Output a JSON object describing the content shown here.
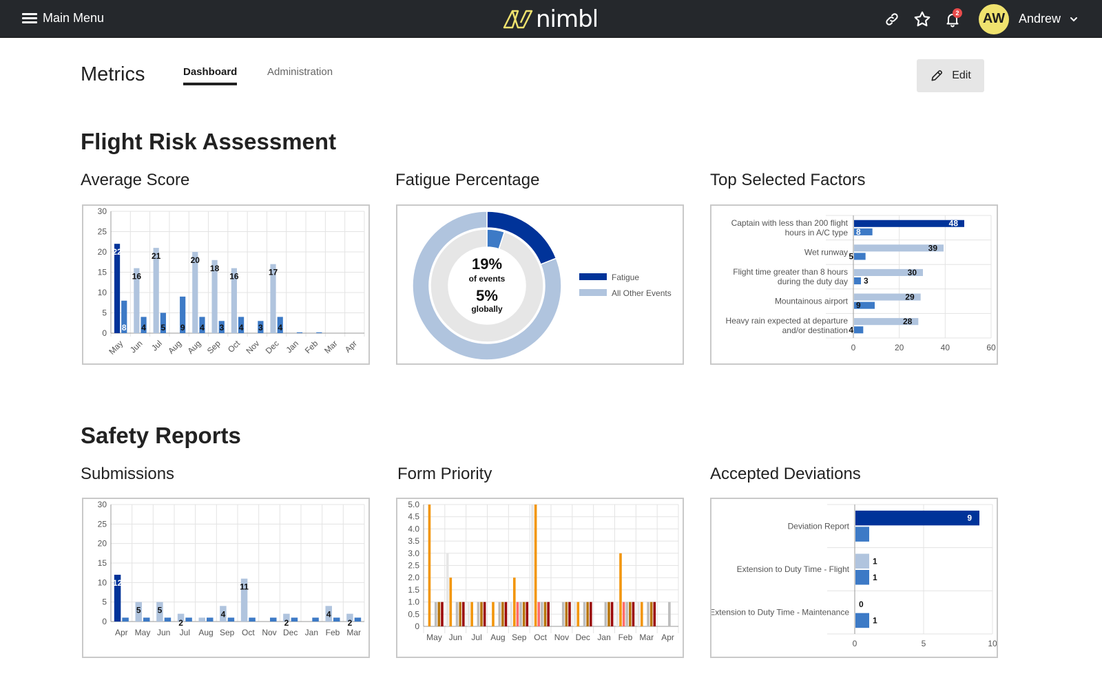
{
  "topbar": {
    "menu_label": "Main Menu",
    "brand": "nimbl",
    "notification_count": "2",
    "avatar_initials": "AW",
    "user_name": "Andrew",
    "brand_color": "#efe26e"
  },
  "header": {
    "title": "Metrics",
    "tabs": [
      {
        "label": "Dashboard",
        "active": true
      },
      {
        "label": "Administration",
        "active": false
      }
    ],
    "edit_label": "Edit"
  },
  "sections": [
    {
      "title": "Flight Risk Assessment"
    },
    {
      "title": "Safety Reports"
    }
  ],
  "chart_titles": {
    "average_score": "Average Score",
    "fatigue": "Fatigue Percentage",
    "top_factors": "Top Selected Factors",
    "submissions": "Submissions",
    "form_priority": "Form Priority",
    "accepted_deviations": "Accepted Deviations"
  },
  "chart_data": [
    {
      "id": "average_score",
      "type": "bar",
      "title": "Average Score",
      "categories": [
        "May",
        "Jun",
        "Jul",
        "Aug",
        "Aug",
        "Sep",
        "Oct",
        "Nov",
        "Dec",
        "Jan",
        "Feb",
        "Mar",
        "Apr"
      ],
      "series": [
        {
          "name": "highlight",
          "color": "#003399",
          "values": [
            22,
            null,
            null,
            null,
            null,
            null,
            null,
            null,
            null,
            null,
            null,
            null,
            null
          ]
        },
        {
          "name": "average",
          "color": "#b0c4de",
          "values": [
            null,
            16,
            21,
            null,
            20,
            18,
            16,
            null,
            17,
            null,
            null,
            null,
            null
          ]
        },
        {
          "name": "count",
          "color": "#3d7ac6",
          "values": [
            8,
            4,
            5,
            9,
            4,
            3,
            4,
            3,
            4,
            0.2,
            0.2,
            0,
            0
          ]
        }
      ],
      "labels": {
        "highlight": [
          "22"
        ],
        "average": [
          "16",
          "21",
          "20",
          "18",
          "16",
          "17"
        ],
        "count": [
          "8",
          "4",
          "5",
          "9",
          "4",
          "3",
          "4",
          "3",
          "4"
        ]
      },
      "yticks": [
        0,
        5,
        10,
        15,
        20,
        25,
        30
      ],
      "ylim": [
        0,
        30
      ],
      "grid": true
    },
    {
      "id": "fatigue",
      "type": "pie",
      "title": "Fatigue Percentage",
      "outer": [
        {
          "label": "Fatigue",
          "value": 19,
          "color": "#003399"
        },
        {
          "label": "All Other Events",
          "value": 81,
          "color": "#b0c4de"
        }
      ],
      "inner": [
        {
          "label": "Fatigue globally",
          "value": 5,
          "color": "#3d7ac6"
        },
        {
          "label": "Other",
          "value": 95,
          "color": "#e6e6e6"
        }
      ],
      "center": {
        "pct1": "19%",
        "line1": "of events",
        "pct2": "5%",
        "line2": "globally"
      },
      "legend": [
        {
          "label": "Fatigue",
          "color": "#003399"
        },
        {
          "label": "All Other Events",
          "color": "#b0c4de"
        }
      ],
      "legend_position": "right"
    },
    {
      "id": "top_factors",
      "type": "bar",
      "orientation": "horizontal",
      "title": "Top Selected Factors",
      "categories": [
        [
          "Captain with less than 200 flight",
          "hours in A/C type"
        ],
        [
          "Wet runway"
        ],
        [
          "Flight time greater than 8 hours",
          "during the duty day"
        ],
        [
          "Mountainous airport"
        ],
        [
          "Heavy rain expected at departure",
          "and/or destination"
        ]
      ],
      "series": [
        {
          "name": "primary",
          "values": [
            48,
            39,
            30,
            29,
            28
          ],
          "colors": [
            "#003399",
            "#b0c4de",
            "#b0c4de",
            "#b0c4de",
            "#b0c4de"
          ]
        },
        {
          "name": "secondary",
          "color": "#3d7ac6",
          "values": [
            8,
            5,
            3,
            9,
            4
          ]
        }
      ],
      "xticks": [
        0,
        20,
        40,
        60
      ],
      "xlim": [
        0,
        60
      ],
      "grid": true
    },
    {
      "id": "submissions",
      "type": "bar",
      "title": "Submissions",
      "categories": [
        "Apr",
        "May",
        "Jun",
        "Jul",
        "Aug",
        "Sep",
        "Oct",
        "Nov",
        "Dec",
        "Jan",
        "Feb",
        "Mar"
      ],
      "series": [
        {
          "name": "primary",
          "values": [
            12,
            5,
            5,
            2,
            1,
            4,
            11,
            0,
            2,
            0,
            4,
            2
          ],
          "colors": [
            "#003399",
            "#b0c4de",
            "#b0c4de",
            "#b0c4de",
            "#b0c4de",
            "#b0c4de",
            "#b0c4de",
            "#b0c4de",
            "#b0c4de",
            "#b0c4de",
            "#b0c4de",
            "#b0c4de"
          ]
        },
        {
          "name": "secondary",
          "color": "#3d7ac6",
          "values": [
            1,
            1,
            1,
            1,
            1,
            1,
            1,
            1,
            1,
            1,
            1,
            1
          ]
        }
      ],
      "labels": [
        "12",
        "5",
        "5",
        "2",
        "",
        "4",
        "11",
        "",
        "2",
        "",
        "4",
        "2"
      ],
      "yticks": [
        0,
        5,
        10,
        15,
        20,
        25,
        30
      ],
      "ylim": [
        0,
        30
      ],
      "grid": true
    },
    {
      "id": "form_priority",
      "type": "bar",
      "title": "Form Priority",
      "categories": [
        "May",
        "Jun",
        "Jul",
        "Aug",
        "Sep",
        "Oct",
        "Nov",
        "Dec",
        "Jan",
        "Feb",
        "Mar",
        "Apr"
      ],
      "series": [
        {
          "name": "s1",
          "color": "#e6e6e6",
          "values": [
            0,
            3,
            1,
            0,
            1,
            5,
            0,
            1,
            0,
            1,
            1,
            0
          ]
        },
        {
          "name": "s2",
          "color": "#f2960d",
          "values": [
            5,
            2,
            1,
            1,
            2,
            5,
            0,
            1,
            0,
            3,
            1,
            0
          ]
        },
        {
          "name": "s3",
          "color": "#ff6b6b",
          "values": [
            0,
            0,
            0,
            0,
            1,
            1,
            0,
            0,
            0,
            1,
            0,
            0
          ]
        },
        {
          "name": "s4",
          "color": "#bdbdbd",
          "values": [
            1,
            1,
            1,
            1,
            1,
            1,
            1,
            1,
            1,
            1,
            1,
            1
          ]
        },
        {
          "name": "s5",
          "color": "#b8740b",
          "values": [
            1,
            1,
            1,
            1,
            1,
            1,
            1,
            1,
            1,
            1,
            1,
            0
          ]
        },
        {
          "name": "s6",
          "color": "#9b0a0a",
          "values": [
            1,
            1,
            1,
            1,
            1,
            1,
            1,
            1,
            1,
            1,
            1,
            0
          ]
        }
      ],
      "yticks": [
        "0",
        "0.5",
        "1.0",
        "1.5",
        "2.0",
        "2.5",
        "3.0",
        "3.5",
        "4.0",
        "4.5",
        "5.0"
      ],
      "ylim": [
        0,
        5
      ],
      "grid": true
    },
    {
      "id": "accepted_deviations",
      "type": "bar",
      "orientation": "horizontal",
      "title": "Accepted Deviations",
      "categories": [
        "Deviation Report",
        "Extension to Duty Time - Flight",
        "Extension to Duty Time - Maintenance"
      ],
      "series": [
        {
          "name": "primary",
          "values": [
            9,
            1,
            0
          ],
          "colors": [
            "#003399",
            "#b0c4de",
            "#b0c4de"
          ]
        },
        {
          "name": "secondary",
          "color": "#3d7ac6",
          "values": [
            1,
            1,
            1
          ]
        }
      ],
      "labels_primary": [
        "9",
        "1",
        "0"
      ],
      "labels_secondary": [
        "",
        "1",
        "1"
      ],
      "xticks": [
        0,
        5,
        10
      ],
      "xlim": [
        0,
        10
      ],
      "grid": true
    }
  ]
}
